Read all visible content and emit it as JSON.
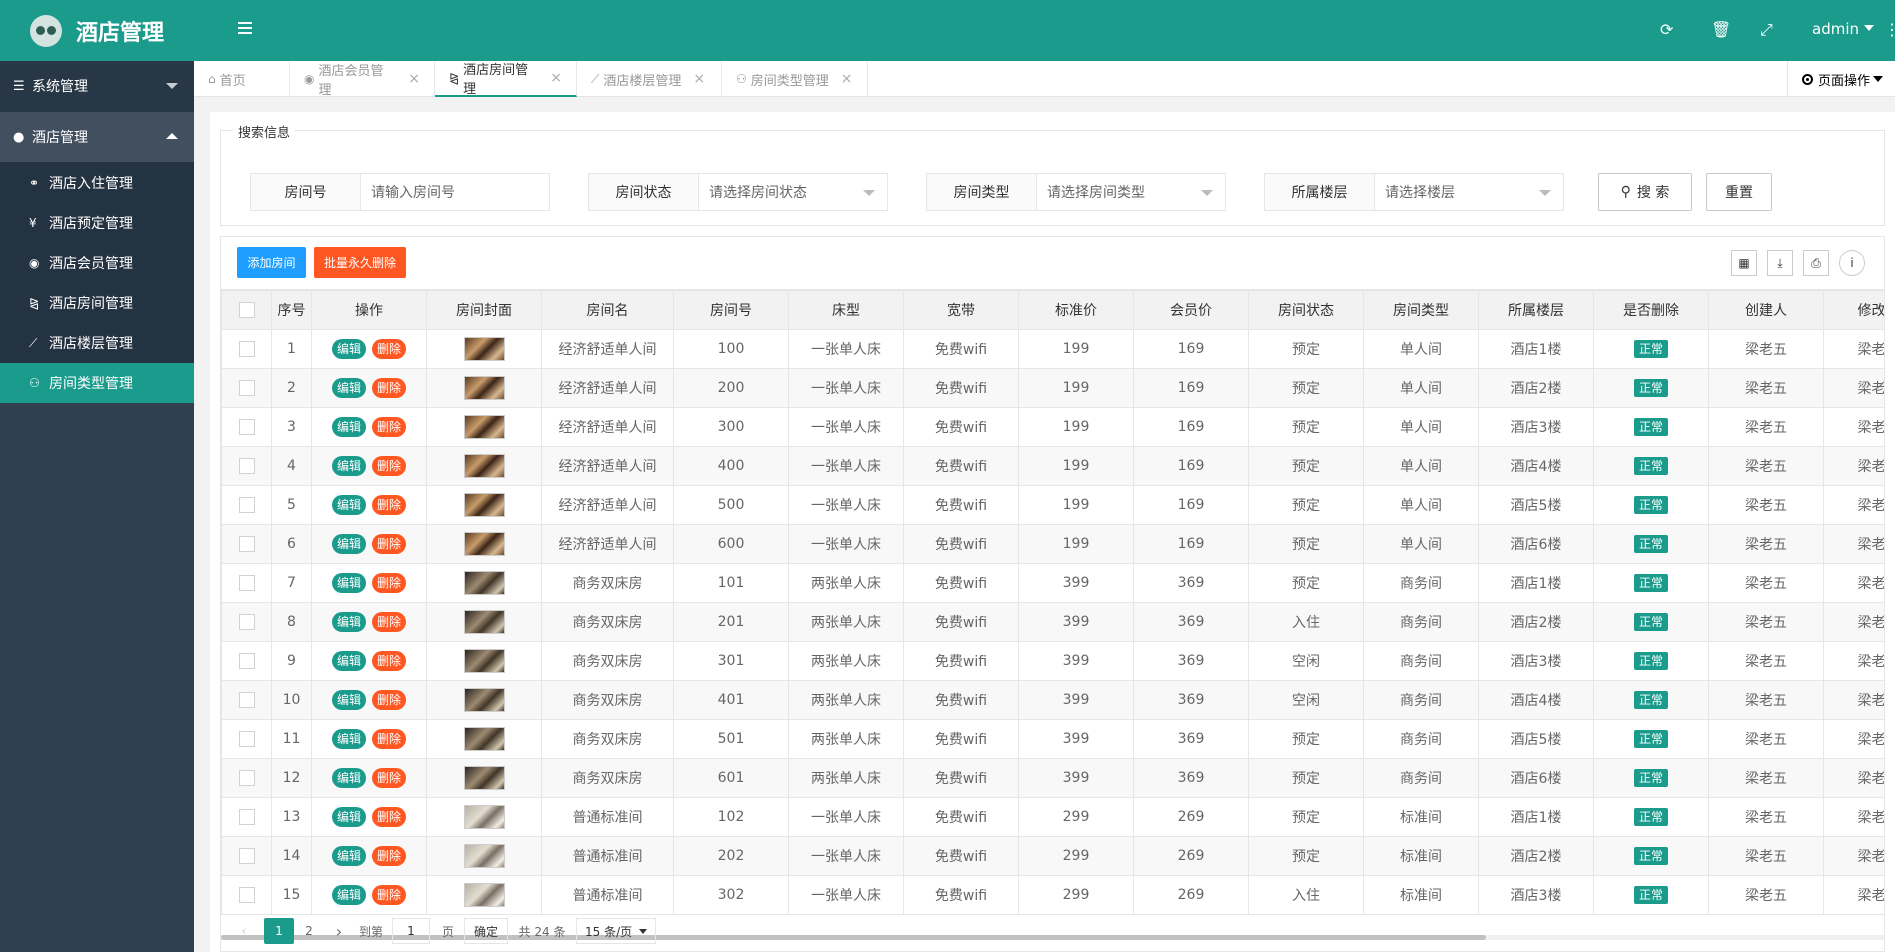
{
  "app": {
    "title": "酒店管理"
  },
  "sidebar": {
    "groups": [
      {
        "label": "系统管理",
        "icon": "bars-icon"
      },
      {
        "label": "酒店管理",
        "icon": "dot-icon"
      }
    ],
    "items": [
      {
        "label": "酒店入住管理",
        "icon": "bicycle-icon"
      },
      {
        "label": "酒店预定管理",
        "icon": "yen-icon"
      },
      {
        "label": "酒店会员管理",
        "icon": "user-icon"
      },
      {
        "label": "酒店房间管理",
        "icon": "binoculars-icon"
      },
      {
        "label": "酒店楼层管理",
        "icon": "eraser-icon"
      },
      {
        "label": "房间类型管理",
        "icon": "motorcycle-icon"
      }
    ]
  },
  "header": {
    "user": "admin"
  },
  "tabs": [
    {
      "label": "首页",
      "closable": false
    },
    {
      "label": "酒店会员管理",
      "closable": true
    },
    {
      "label": "酒店房间管理",
      "closable": true,
      "active": true
    },
    {
      "label": "酒店楼层管理",
      "closable": true
    },
    {
      "label": "房间类型管理",
      "closable": true
    }
  ],
  "page_ops": "页面操作",
  "search": {
    "legend": "搜索信息",
    "room_no": {
      "label": "房间号",
      "placeholder": "请输入房间号"
    },
    "status": {
      "label": "房间状态",
      "placeholder": "请选择房间状态"
    },
    "type": {
      "label": "房间类型",
      "placeholder": "请选择房间类型"
    },
    "floor": {
      "label": "所属楼层",
      "placeholder": "请选择楼层"
    },
    "search_btn": "搜 索",
    "reset_btn": "重置"
  },
  "toolbar": {
    "add": "添加房间",
    "batch_delete": "批量永久删除"
  },
  "table": {
    "headers": [
      "序号",
      "操作",
      "房间封面",
      "房间名",
      "房间号",
      "床型",
      "宽带",
      "标准价",
      "会员价",
      "房间状态",
      "房间类型",
      "所属楼层",
      "是否删除",
      "创建人",
      "修改"
    ],
    "edit_label": "编辑",
    "delete_label": "删除",
    "rows": [
      [
        "1",
        "经济舒适单人间",
        "100",
        "一张单人床",
        "免费wifi",
        "199",
        "169",
        "预定",
        "单人间",
        "酒店1楼",
        "正常",
        "梁老五",
        "梁老"
      ],
      [
        "2",
        "经济舒适单人间",
        "200",
        "一张单人床",
        "免费wifi",
        "199",
        "169",
        "预定",
        "单人间",
        "酒店2楼",
        "正常",
        "梁老五",
        "梁老"
      ],
      [
        "3",
        "经济舒适单人间",
        "300",
        "一张单人床",
        "免费wifi",
        "199",
        "169",
        "预定",
        "单人间",
        "酒店3楼",
        "正常",
        "梁老五",
        "梁老"
      ],
      [
        "4",
        "经济舒适单人间",
        "400",
        "一张单人床",
        "免费wifi",
        "199",
        "169",
        "预定",
        "单人间",
        "酒店4楼",
        "正常",
        "梁老五",
        "梁老"
      ],
      [
        "5",
        "经济舒适单人间",
        "500",
        "一张单人床",
        "免费wifi",
        "199",
        "169",
        "预定",
        "单人间",
        "酒店5楼",
        "正常",
        "梁老五",
        "梁老"
      ],
      [
        "6",
        "经济舒适单人间",
        "600",
        "一张单人床",
        "免费wifi",
        "199",
        "169",
        "预定",
        "单人间",
        "酒店6楼",
        "正常",
        "梁老五",
        "梁老"
      ],
      [
        "7",
        "商务双床房",
        "101",
        "两张单人床",
        "免费wifi",
        "399",
        "369",
        "预定",
        "商务间",
        "酒店1楼",
        "正常",
        "梁老五",
        "梁老"
      ],
      [
        "8",
        "商务双床房",
        "201",
        "两张单人床",
        "免费wifi",
        "399",
        "369",
        "入住",
        "商务间",
        "酒店2楼",
        "正常",
        "梁老五",
        "梁老"
      ],
      [
        "9",
        "商务双床房",
        "301",
        "两张单人床",
        "免费wifi",
        "399",
        "369",
        "空闲",
        "商务间",
        "酒店3楼",
        "正常",
        "梁老五",
        "梁老"
      ],
      [
        "10",
        "商务双床房",
        "401",
        "两张单人床",
        "免费wifi",
        "399",
        "369",
        "空闲",
        "商务间",
        "酒店4楼",
        "正常",
        "梁老五",
        "梁老"
      ],
      [
        "11",
        "商务双床房",
        "501",
        "两张单人床",
        "免费wifi",
        "399",
        "369",
        "预定",
        "商务间",
        "酒店5楼",
        "正常",
        "梁老五",
        "梁老"
      ],
      [
        "12",
        "商务双床房",
        "601",
        "两张单人床",
        "免费wifi",
        "399",
        "369",
        "预定",
        "商务间",
        "酒店6楼",
        "正常",
        "梁老五",
        "梁老"
      ],
      [
        "13",
        "普通标准间",
        "102",
        "一张单人床",
        "免费wifi",
        "299",
        "269",
        "预定",
        "标准间",
        "酒店1楼",
        "正常",
        "梁老五",
        "梁老"
      ],
      [
        "14",
        "普通标准间",
        "202",
        "一张单人床",
        "免费wifi",
        "299",
        "269",
        "预定",
        "标准间",
        "酒店2楼",
        "正常",
        "梁老五",
        "梁老"
      ],
      [
        "15",
        "普通标准间",
        "302",
        "一张单人床",
        "免费wifi",
        "299",
        "269",
        "入住",
        "标准间",
        "酒店3楼",
        "正常",
        "梁老五",
        "梁老"
      ]
    ]
  },
  "pager": {
    "pages": [
      "1",
      "2"
    ],
    "current": "1",
    "goto_label": "到第",
    "goto_value": "1",
    "page_unit": "页",
    "confirm": "确定",
    "total": "共 24 条",
    "page_size": "15 条/页"
  },
  "colors": {
    "primary": "#1a9b8c",
    "danger": "#ff5722",
    "info": "#1e9fff",
    "sidebar": "#2f4050"
  }
}
